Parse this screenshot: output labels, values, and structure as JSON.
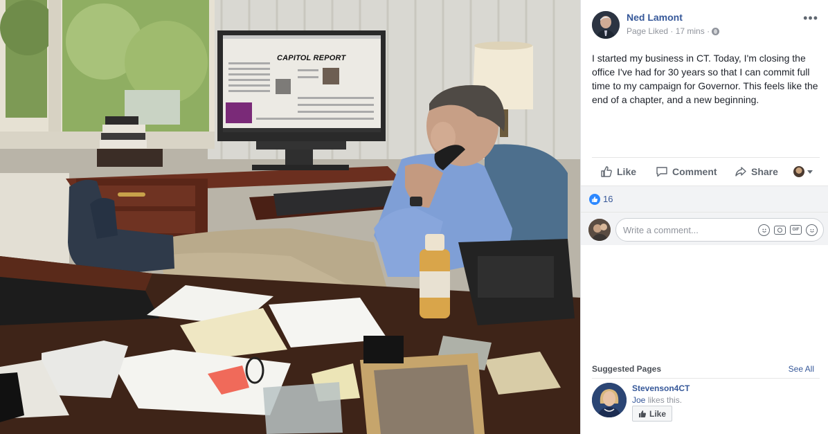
{
  "photo": {
    "monitor_headline": "CAPITOL REPORT"
  },
  "post": {
    "author": "Ned Lamont",
    "meta": "Page Liked · 17 mins ·",
    "text": "I started my business in CT. Today, I'm closing the office I've had for 30 years so that I can commit full time to my campaign for Governor. This feels like the end of a chapter, and a new beginning.",
    "actions": {
      "like": "Like",
      "comment": "Comment",
      "share": "Share"
    },
    "reaction_count": "16",
    "comment_placeholder": "Write a comment..."
  },
  "suggested": {
    "title": "Suggested Pages",
    "see_all": "See All",
    "page": {
      "name": "Stevenson4CT",
      "liked_by": "Joe",
      "liked_by_suffix": " likes this.",
      "like_button": "Like"
    }
  },
  "icons": [
    "globe-icon",
    "more-icon",
    "like-icon",
    "comment-icon",
    "share-icon",
    "emoji-icon",
    "camera-icon",
    "gif-icon",
    "sticker-icon"
  ],
  "colors": {
    "link_blue": "#365899",
    "meta_gray": "#90949c",
    "action_gray": "#606770",
    "reaction_blue": "#2d88ff",
    "panel_gray": "#f2f3f5"
  }
}
